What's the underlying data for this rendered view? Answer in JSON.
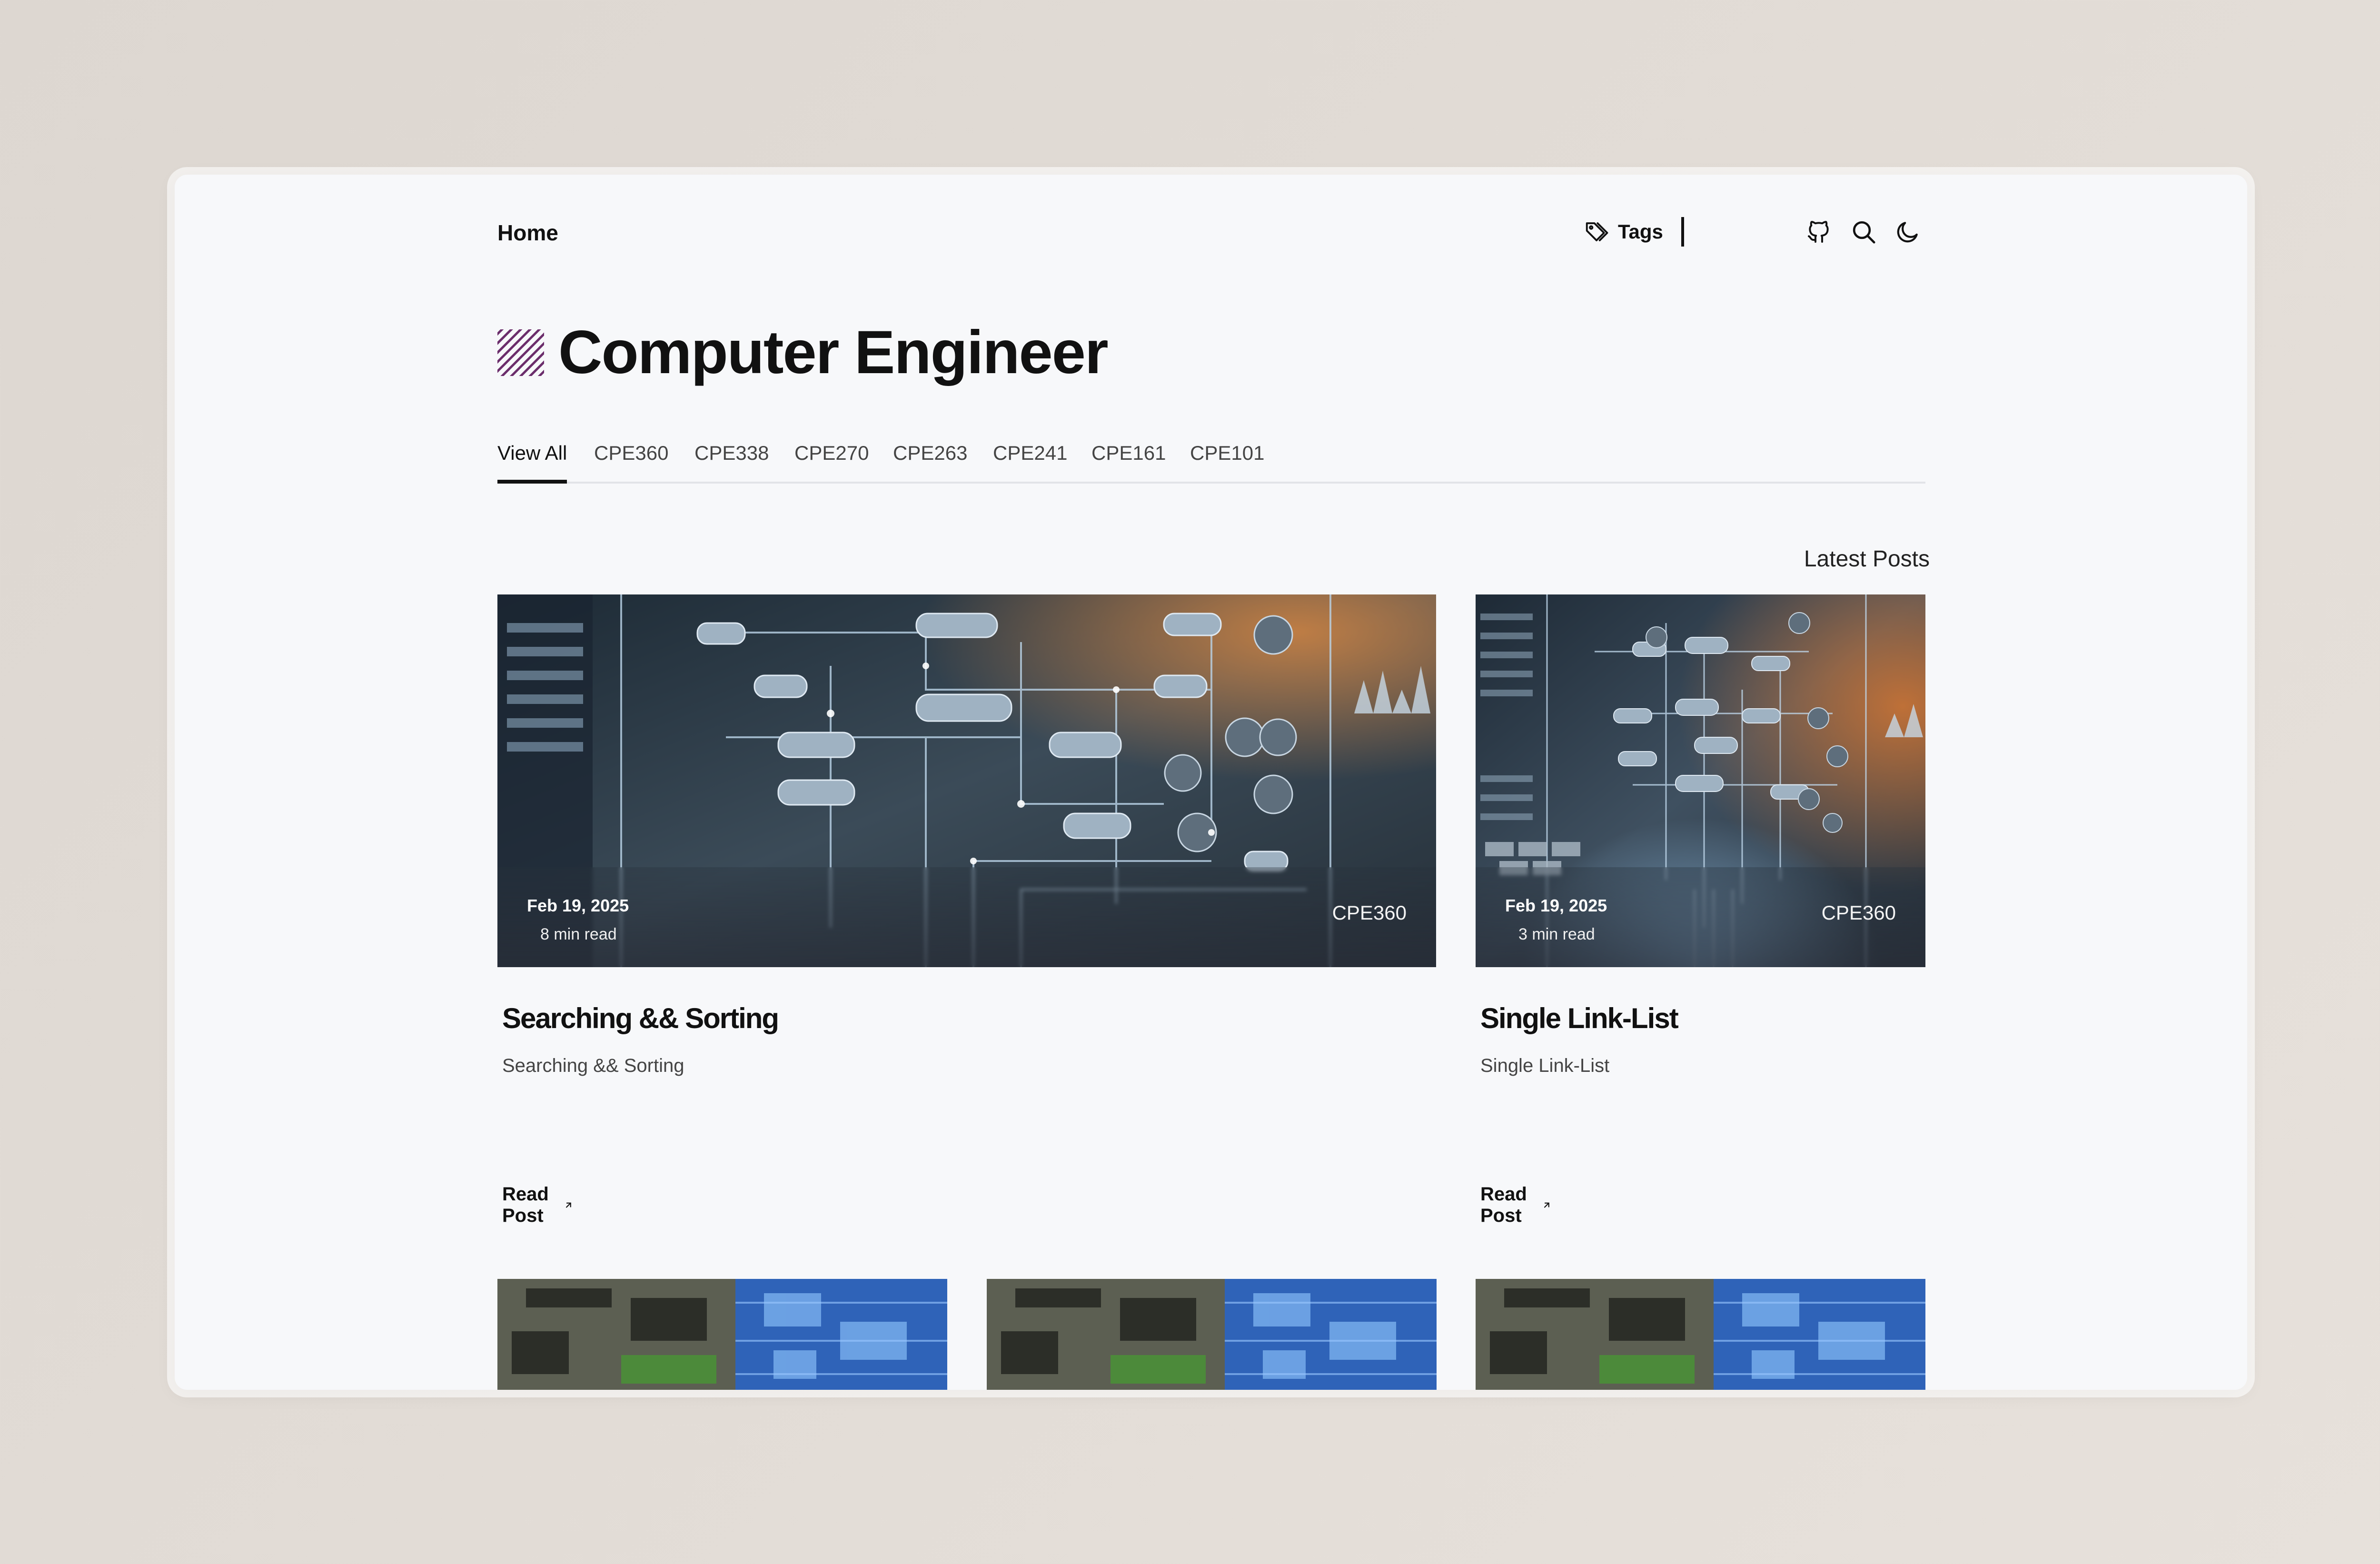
{
  "nav": {
    "home_label": "Home",
    "tags_label": "Tags",
    "icons": [
      "tag-icon",
      "github-icon",
      "search-icon",
      "moon-icon"
    ]
  },
  "page": {
    "title": "Computer Engineer"
  },
  "tabs": [
    {
      "label": "View All",
      "active": true
    },
    {
      "label": "CPE360"
    },
    {
      "label": "CPE338"
    },
    {
      "label": "CPE270"
    },
    {
      "label": "CPE263"
    },
    {
      "label": "CPE241"
    },
    {
      "label": "CPE161"
    },
    {
      "label": "CPE101"
    }
  ],
  "section": {
    "latest_label": "Latest Posts"
  },
  "posts": [
    {
      "date": "Feb 19, 2025",
      "read_time": "8 min read",
      "tag": "CPE360",
      "title": "Searching && Sorting",
      "description": "Searching && Sorting",
      "cta": "Read Post"
    },
    {
      "date": "Feb 19, 2025",
      "read_time": "3 min read",
      "tag": "CPE360",
      "title": "Single Link-List",
      "description": "Single Link-List",
      "cta": "Read Post"
    }
  ],
  "colors": {
    "background": "#f7f8fa",
    "text": "#111111",
    "accent_mark": "#6b2d6b"
  }
}
